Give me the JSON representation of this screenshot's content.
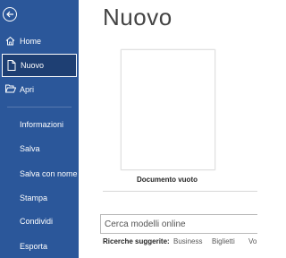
{
  "sidebar": {
    "back_icon": "back-arrow-icon",
    "items": [
      {
        "label": "Home",
        "icon": "home-icon"
      },
      {
        "label": "Nuovo",
        "icon": "new-document-icon",
        "selected": true
      },
      {
        "label": "Apri",
        "icon": "open-folder-icon"
      },
      {
        "label": "Informazioni"
      },
      {
        "label": "Salva"
      },
      {
        "label": "Salva con nome"
      },
      {
        "label": "Stampa"
      },
      {
        "label": "Condividi"
      },
      {
        "label": "Esporta"
      }
    ]
  },
  "main": {
    "title": "Nuovo",
    "templates": [
      {
        "label": "Documento vuoto"
      }
    ],
    "search": {
      "placeholder": "Cerca modelli online"
    },
    "suggested": {
      "label": "Ricerche suggerite:",
      "items": [
        "Business",
        "Biglietti",
        "Vo"
      ]
    }
  },
  "colors": {
    "sidebar_bg": "#2b579a",
    "selected_bg": "#1e3f73"
  }
}
